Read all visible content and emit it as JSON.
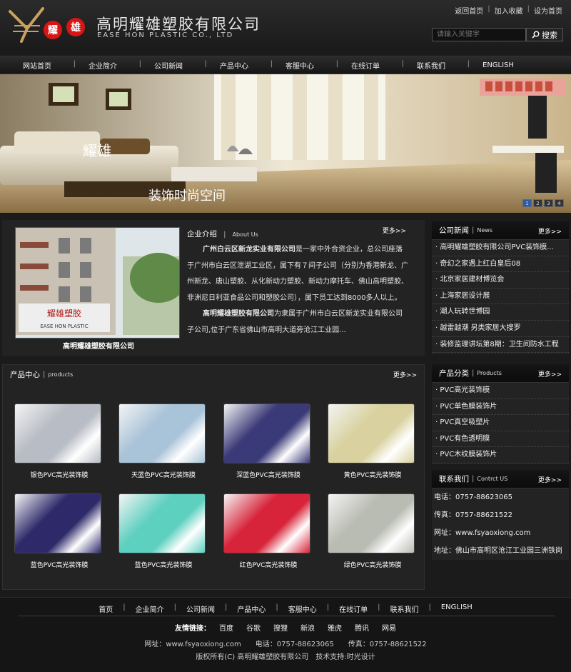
{
  "header": {
    "logo_cn": "高明耀雄塑胶有限公司",
    "logo_en": "EASE HON PLASTIC CO., LTD",
    "logo_chars": [
      "耀",
      "雄"
    ],
    "top_links": [
      "返回首页",
      "加入收藏",
      "设为首页"
    ],
    "search": {
      "placeholder": "请输入关键字",
      "button": "搜索"
    }
  },
  "nav": {
    "items": [
      "网站首页",
      "企业简介",
      "公司新闻",
      "产品中心",
      "客服中心",
      "在线订单",
      "联系我们",
      "ENGLISH"
    ]
  },
  "banner": {
    "title": "耀雄",
    "subtitle": "装饰时尚空间",
    "dots": [
      "1",
      "2",
      "3",
      "4"
    ],
    "active_dot": "1"
  },
  "intro": {
    "heading_cn": "企业介绍",
    "heading_en": "About Us",
    "more": "更多>>",
    "photo_sign": "耀雄塑胶",
    "photo_sign_en": "EASE HON PLASTIC",
    "caption": "高明耀雄塑胶有限公司",
    "para1_bold": "广州白云区新龙实业有限公司",
    "para1": "是一家中外合资企业，总公司座落于广州市白云区泄湖工业区，属下有７间子公司（分别为香港新龙、广州新龙、唐山塑胶、从化新动力塑胶、新动力摩托车、佛山高明塑胶、非洲尼日利亚食品公司和塑胶公司），属下员工达到8000多人以上。",
    "para2_bold": "高明耀雄塑胶有限公司",
    "para2": "为隶属于广州市白云区新龙实业有限公司子公司,位于广东省佛山市高明大道旁沧江工业园..."
  },
  "news": {
    "heading_cn": "公司新闻",
    "heading_en": "News",
    "more": "更多>>",
    "items": [
      "高明耀雄塑胶有限公司PVC装饰膜...",
      "奇幻之家遇上红白皇后08",
      "北京家居建材博览会",
      "上海家居设计展",
      "潮人玩转世博园",
      "越雷越潮 另类家居大搜罗",
      "装修监理讲坛第8期：卫生间防水工程"
    ]
  },
  "products": {
    "heading_cn": "产品中心",
    "heading_en": "products",
    "more": "更多>>",
    "items": [
      {
        "label": "银色PVC高光装饰膜",
        "color": "#b8bcc4"
      },
      {
        "label": "天蓝色PVC高光装饰膜",
        "color": "#a9c3d8"
      },
      {
        "label": "深蓝色PVC高光装饰膜",
        "color": "#3b3a78"
      },
      {
        "label": "黄色PVC高光装饰膜",
        "color": "#d9d2a0"
      },
      {
        "label": "蓝色PVC高光装饰膜",
        "color": "#2e2a6a"
      },
      {
        "label": "蓝色PVC高光装饰膜",
        "color": "#5ed0c0"
      },
      {
        "label": "红色PVC高光装饰膜",
        "color": "#d8243a"
      },
      {
        "label": "绿色PVC高光装饰膜",
        "color": "#b9bcb2"
      }
    ]
  },
  "categories": {
    "heading_cn": "产品分类",
    "heading_en": "Products",
    "more": "更多>>",
    "items": [
      "PVC高光装饰膜",
      "PVC单色膜装饰片",
      "PVC真空吸塑片",
      "PVC有色透明膜",
      "PVC木纹膜装饰片"
    ]
  },
  "contact": {
    "heading_cn": "联系我们",
    "heading_en": "Contrct US",
    "more": "更多>>",
    "items": [
      "电话：0757-88623065",
      "传真：0757-88621522",
      "网址：www.fsyaoxiong.com",
      "地址：佛山市高明区沧江工业园三洲铁岗"
    ]
  },
  "footer": {
    "nav": [
      "首页",
      "企业简介",
      "公司新闻",
      "产品中心",
      "客服中心",
      "在线订单",
      "联系我们",
      "ENGLISH"
    ],
    "friend_label": "友情链接：",
    "friend_links": [
      "百度",
      "谷歌",
      "搜狸",
      "新浪",
      "雅虎",
      "腾讯",
      "网易"
    ],
    "info": "网址：www.fsyaoxiong.com　　电话：0757-88623065　　传真：0757-88621522",
    "copyright": "版权所有(C) 高明耀雄塑胶有限公司　技术支持:时光设计"
  },
  "colors": {
    "logo_red": "#d81414",
    "accent_blue": "#2a5fa8",
    "background": "#1b1b1b"
  }
}
